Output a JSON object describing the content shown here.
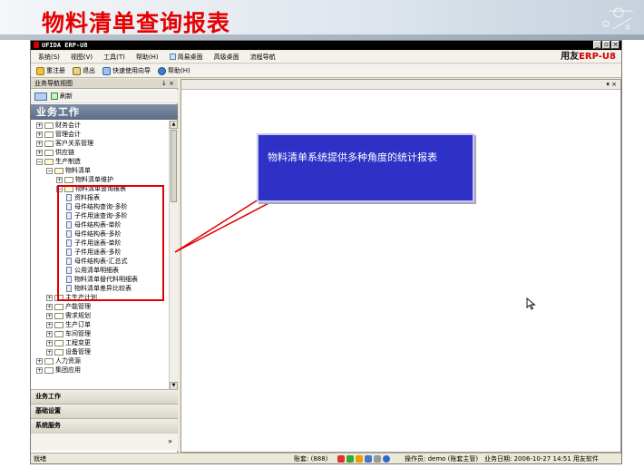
{
  "slide": {
    "title": "物料清单查询报表"
  },
  "window": {
    "title": "UFIDA ERP-U8",
    "brand_prefix": "用友",
    "brand_suffix": "ERP-U8",
    "controls": [
      "_",
      "▫",
      "×"
    ]
  },
  "menu": [
    "系统(S)",
    "视图(V)",
    "工具(T)",
    "帮助(H)",
    "简易桌面",
    "高级桌面",
    "流程导航"
  ],
  "toolbar": [
    "重注册",
    "退出",
    "快速使用向导",
    "帮助(H)"
  ],
  "nav": {
    "header": "业务导航视图",
    "pin": "↓ ×",
    "refresh": "刷新",
    "section_title": "业务工作",
    "tree": [
      {
        "label": "财务会计",
        "level": 0,
        "type": "folder",
        "expanded": false
      },
      {
        "label": "管理会计",
        "level": 0,
        "type": "folder",
        "expanded": false
      },
      {
        "label": "客户关系管理",
        "level": 0,
        "type": "folder",
        "expanded": false
      },
      {
        "label": "供应链",
        "level": 0,
        "type": "folder",
        "expanded": false
      },
      {
        "label": "生产制造",
        "level": 0,
        "type": "folder",
        "expanded": true
      },
      {
        "label": "物料清单",
        "level": 1,
        "type": "folder",
        "expanded": true
      },
      {
        "label": "物料清单维护",
        "level": 2,
        "type": "folder",
        "expanded": false
      },
      {
        "label": "物料清单查询报表",
        "level": 2,
        "type": "folder",
        "expanded": true
      },
      {
        "label": "资料报表",
        "level": 3,
        "type": "doc"
      },
      {
        "label": "母件结构查询-多阶",
        "level": 3,
        "type": "doc"
      },
      {
        "label": "子件用途查询-多阶",
        "level": 3,
        "type": "doc"
      },
      {
        "label": "母件结构表-单阶",
        "level": 3,
        "type": "doc"
      },
      {
        "label": "母件结构表-多阶",
        "level": 3,
        "type": "doc"
      },
      {
        "label": "子件用途表-单阶",
        "level": 3,
        "type": "doc"
      },
      {
        "label": "子件用途表-多阶",
        "level": 3,
        "type": "doc"
      },
      {
        "label": "母件结构表-汇总式",
        "level": 3,
        "type": "doc"
      },
      {
        "label": "公用清单明细表",
        "level": 3,
        "type": "doc"
      },
      {
        "label": "物料清单替代料明细表",
        "level": 3,
        "type": "doc"
      },
      {
        "label": "物料清单差异比较表",
        "level": 3,
        "type": "doc"
      },
      {
        "label": "主生产计划",
        "level": 1,
        "type": "folder",
        "expanded": false
      },
      {
        "label": "产能管理",
        "level": 1,
        "type": "folder",
        "expanded": false
      },
      {
        "label": "需求规划",
        "level": 1,
        "type": "folder",
        "expanded": false
      },
      {
        "label": "生产订单",
        "level": 1,
        "type": "folder",
        "expanded": false
      },
      {
        "label": "车间管理",
        "level": 1,
        "type": "folder",
        "expanded": false
      },
      {
        "label": "工程变更",
        "level": 1,
        "type": "folder",
        "expanded": false
      },
      {
        "label": "设备管理",
        "level": 1,
        "type": "folder",
        "expanded": false
      },
      {
        "label": "人力资源",
        "level": 0,
        "type": "folder",
        "expanded": false
      },
      {
        "label": "集团应用",
        "level": 0,
        "type": "folder",
        "expanded": false
      }
    ],
    "sections": [
      "业务工作",
      "基础设置",
      "系统服务"
    ],
    "chevron": "»"
  },
  "content": {
    "controls": "▾ ×"
  },
  "callout": {
    "text": "物料清单系统提供多种角度的统计报表"
  },
  "status": {
    "left": "就绪",
    "account": "账套: (888)",
    "operator": "操作员: demo (账套主管)",
    "date": "业务日期: 2006-10-27  14:51  用友软件"
  },
  "colors": {
    "title_red": "#e60000",
    "callout_blue": "#2e31c6",
    "highlight_red": "#e00000"
  }
}
